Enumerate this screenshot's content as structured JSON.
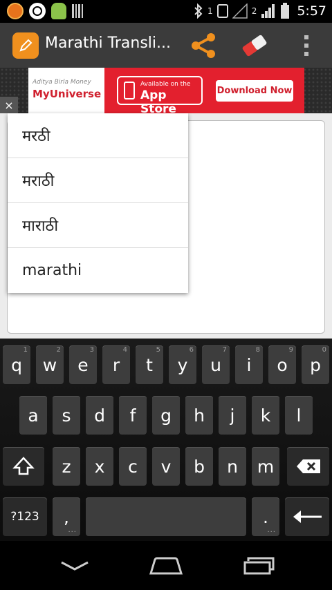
{
  "status_bar": {
    "time": "5:57",
    "sim1_label": "1",
    "sim2_label": "2"
  },
  "action_bar": {
    "title": "Marathi Transli..."
  },
  "ad": {
    "brand_small": "Aditya Birla Money",
    "brand": "MyUniverse",
    "available": "Available on the",
    "store": "App Store",
    "cta": "Download Now",
    "close": "×"
  },
  "suggestions": [
    {
      "text": "मरठी"
    },
    {
      "text": "मराठी"
    },
    {
      "text": "माराठी"
    },
    {
      "text": "marathi"
    }
  ],
  "keyboard": {
    "row1": [
      {
        "label": "q",
        "hint": "1"
      },
      {
        "label": "w",
        "hint": "2"
      },
      {
        "label": "e",
        "hint": "3"
      },
      {
        "label": "r",
        "hint": "4"
      },
      {
        "label": "t",
        "hint": "5"
      },
      {
        "label": "y",
        "hint": "6"
      },
      {
        "label": "u",
        "hint": "7"
      },
      {
        "label": "i",
        "hint": "8"
      },
      {
        "label": "o",
        "hint": "9"
      },
      {
        "label": "p",
        "hint": "0"
      }
    ],
    "row2": [
      "a",
      "s",
      "d",
      "f",
      "g",
      "h",
      "j",
      "k",
      "l"
    ],
    "row3": [
      "z",
      "x",
      "c",
      "v",
      "b",
      "n",
      "m"
    ],
    "symbols_label": "?123",
    "comma_label": ",",
    "period_label": "."
  },
  "colors": {
    "accent_orange": "#f0901e",
    "ad_red": "#e3202e",
    "actionbar": "#3b3b3b"
  },
  "icons": [
    "app-pencil-icon",
    "share-icon",
    "eraser-icon",
    "overflow-menu-icon",
    "shift-icon",
    "backspace-icon",
    "enter-icon",
    "back-icon",
    "home-icon",
    "recents-icon"
  ]
}
